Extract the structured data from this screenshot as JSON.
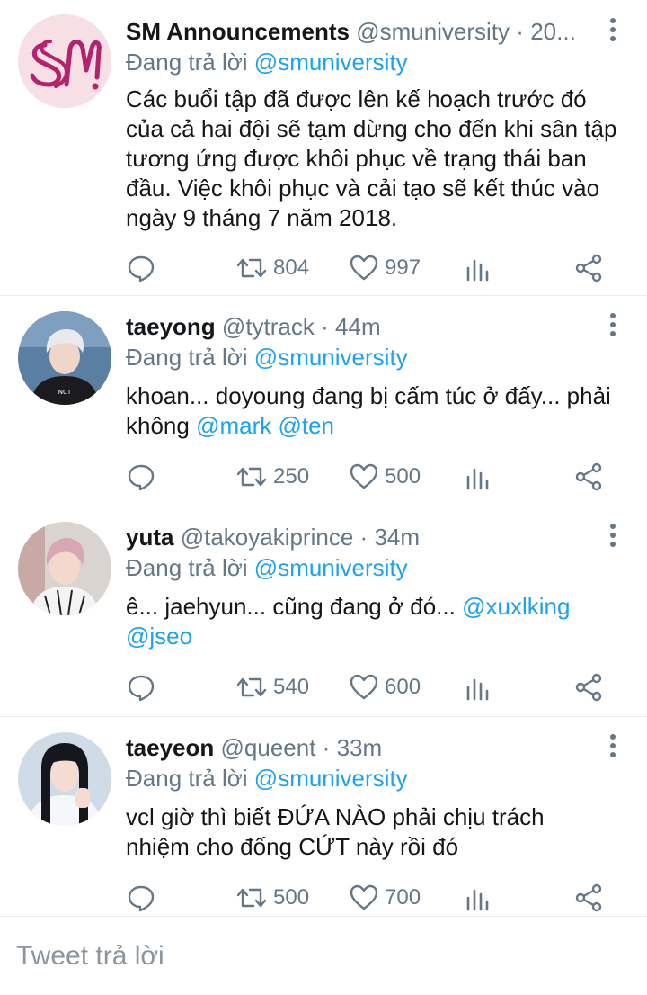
{
  "tweets": [
    {
      "name": "SM Announcements",
      "handle": "@smuniversity",
      "time": "20...",
      "reply_prefix": "Đang trả lời",
      "reply_to": "@smuniversity",
      "text": "Các buổi tập đã được lên kế hoạch trước đó của cả hai đội sẽ tạm dừng cho đến khi sân tập tương ứng được khôi phục về trạng thái ban đầu. Việc khôi phục và cải tạo sẽ kết thúc vào ngày 9 tháng 7 năm 2018.",
      "retweets": "804",
      "likes": "997",
      "avatar": "sm-logo"
    },
    {
      "name": "taeyong",
      "handle": "@tytrack",
      "time": "44m",
      "reply_prefix": "Đang trả lời",
      "reply_to": "@smuniversity",
      "text_lead": "khoan... doyoung đang bị cấm túc ở đấy... phải không",
      "mentions": [
        "@mark",
        "@ten"
      ],
      "retweets": "250",
      "likes": "500",
      "avatar": "user-photo"
    },
    {
      "name": "yuta",
      "handle": "@takoyakiprince",
      "time": "34m",
      "reply_prefix": "Đang trả lời",
      "reply_to": "@smuniversity",
      "text_lead": "ê... jaehyun... cũng đang ở đó...",
      "mentions": [
        "@xuxlking",
        "@jseo"
      ],
      "retweets": "540",
      "likes": "600",
      "avatar": "user-photo"
    },
    {
      "name": "taeyeon",
      "handle": "@queent",
      "time": "33m",
      "reply_prefix": "Đang trả lời",
      "reply_to": "@smuniversity",
      "text": "vcl giờ thì biết ĐỨA NÀO phải chịu trách nhiệm cho đống CỨT này rồi đó",
      "retweets": "500",
      "likes": "700",
      "avatar": "user-photo"
    }
  ],
  "composer": {
    "placeholder": "Tweet trả lời"
  },
  "colors": {
    "accent": "#1da1f2",
    "muted": "#657786",
    "divider": "#e6ecf0",
    "sm_pink": "#f7dfe6",
    "sm_logo": "#b5226b"
  }
}
